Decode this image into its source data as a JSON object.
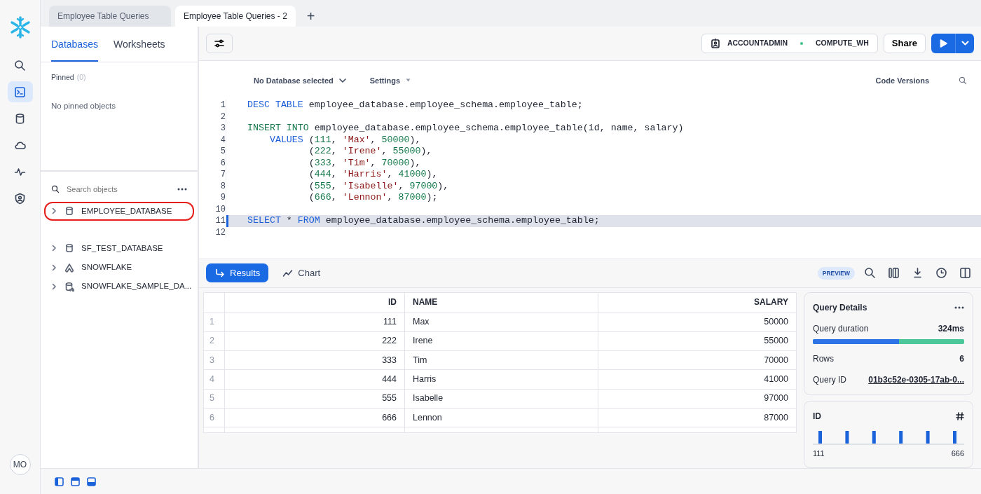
{
  "window_tabs": [
    {
      "label": "Employee Table Queries",
      "selected": false
    },
    {
      "label": "Employee Table Queries - 2",
      "selected": true
    }
  ],
  "new_tab": "+",
  "rail": [
    {
      "kind": "search",
      "selected": false
    },
    {
      "kind": "worksheet",
      "selected": true
    },
    {
      "kind": "data",
      "selected": false
    },
    {
      "kind": "cloud",
      "selected": false
    },
    {
      "kind": "activity",
      "selected": false
    },
    {
      "kind": "shield",
      "selected": false
    }
  ],
  "avatar": "MO",
  "sidebar": {
    "tabs": [
      {
        "label": "Databases",
        "selected": true
      },
      {
        "label": "Worksheets",
        "selected": false
      }
    ],
    "pinned_label": "Pinned",
    "pinned_count": "(0)",
    "pinned_empty": "No pinned objects",
    "search": {
      "placeholder": "Search objects"
    },
    "objects": [
      {
        "kind": "database",
        "name": "EMPLOYEE_DATABASE",
        "circled": true
      },
      {
        "kind": "database",
        "name": "SF_TEST_DATABASE",
        "circled": false
      },
      {
        "kind": "app",
        "name": "SNOWFLAKE",
        "circled": false
      },
      {
        "kind": "shared",
        "name": "SNOWFLAKE_SAMPLE_DA...",
        "circled": false
      }
    ]
  },
  "toolbar": {
    "role": "ACCOUNTADMIN",
    "warehouse": "COMPUTE_WH",
    "share": "Share"
  },
  "editor": {
    "database": "No Database selected",
    "settings": "Settings",
    "code_versions": "Code Versions",
    "lines": [
      {
        "number": "1",
        "highlighted": false,
        "tokens": [
          {
            "kind": "kw",
            "t": "DESC TABLE"
          },
          {
            "kind": "txt",
            "t": " employee_database.employee_schema.employee_table;"
          }
        ]
      },
      {
        "number": "2",
        "highlighted": false
      },
      {
        "number": "3",
        "highlighted": false,
        "tokens": [
          {
            "kind": "kw2",
            "t": "INSERT INTO"
          },
          {
            "kind": "txt",
            "t": " employee_database.employee_schema.employee_table(id, name, salary)"
          }
        ]
      },
      {
        "number": "4",
        "highlighted": false,
        "tokens": [
          {
            "kind": "kw",
            "t": "    VALUES"
          },
          {
            "kind": "txt",
            "t": " ("
          },
          {
            "kind": "num",
            "t": "111"
          },
          {
            "kind": "txt",
            "t": ", "
          },
          {
            "kind": "str",
            "t": "'Max'"
          },
          {
            "kind": "txt",
            "t": ", "
          },
          {
            "kind": "num",
            "t": "50000"
          },
          {
            "kind": "txt",
            "t": "),"
          }
        ]
      },
      {
        "number": "5",
        "highlighted": false,
        "tokens": [
          {
            "kind": "txt",
            "t": "           ("
          },
          {
            "kind": "num",
            "t": "222"
          },
          {
            "kind": "txt",
            "t": ", "
          },
          {
            "kind": "str",
            "t": "'Irene'"
          },
          {
            "kind": "txt",
            "t": ", "
          },
          {
            "kind": "num",
            "t": "55000"
          },
          {
            "kind": "txt",
            "t": "),"
          }
        ]
      },
      {
        "number": "6",
        "highlighted": false,
        "tokens": [
          {
            "kind": "txt",
            "t": "           ("
          },
          {
            "kind": "num",
            "t": "333"
          },
          {
            "kind": "txt",
            "t": ", "
          },
          {
            "kind": "str",
            "t": "'Tim'"
          },
          {
            "kind": "txt",
            "t": ", "
          },
          {
            "kind": "num",
            "t": "70000"
          },
          {
            "kind": "txt",
            "t": "),"
          }
        ]
      },
      {
        "number": "7",
        "highlighted": false,
        "tokens": [
          {
            "kind": "txt",
            "t": "           ("
          },
          {
            "kind": "num",
            "t": "444"
          },
          {
            "kind": "txt",
            "t": ", "
          },
          {
            "kind": "str",
            "t": "'Harris'"
          },
          {
            "kind": "txt",
            "t": ", "
          },
          {
            "kind": "num",
            "t": "41000"
          },
          {
            "kind": "txt",
            "t": "),"
          }
        ]
      },
      {
        "number": "8",
        "highlighted": false,
        "tokens": [
          {
            "kind": "txt",
            "t": "           ("
          },
          {
            "kind": "num",
            "t": "555"
          },
          {
            "kind": "txt",
            "t": ", "
          },
          {
            "kind": "str",
            "t": "'Isabelle'"
          },
          {
            "kind": "txt",
            "t": ", "
          },
          {
            "kind": "num",
            "t": "97000"
          },
          {
            "kind": "txt",
            "t": "),"
          }
        ]
      },
      {
        "number": "9",
        "highlighted": false,
        "tokens": [
          {
            "kind": "txt",
            "t": "           ("
          },
          {
            "kind": "num",
            "t": "666"
          },
          {
            "kind": "txt",
            "t": ", "
          },
          {
            "kind": "str",
            "t": "'Lennon'"
          },
          {
            "kind": "txt",
            "t": ", "
          },
          {
            "kind": "num",
            "t": "87000"
          },
          {
            "kind": "txt",
            "t": ");"
          }
        ]
      },
      {
        "number": "10",
        "highlighted": false
      },
      {
        "number": "11",
        "highlighted": true,
        "tokens": [
          {
            "kind": "kw",
            "t": "SELECT"
          },
          {
            "kind": "txt",
            "t": " * "
          },
          {
            "kind": "kw",
            "t": "FROM"
          },
          {
            "kind": "txt",
            "t": " employee_database.employee_schema.employee_table;"
          }
        ]
      },
      {
        "number": "12",
        "highlighted": false
      }
    ]
  },
  "results": {
    "tabs": [
      {
        "kind": "results",
        "label": "Results",
        "selected": true
      },
      {
        "kind": "chart",
        "label": "Chart",
        "selected": false
      }
    ],
    "badge": "PREVIEW",
    "table": {
      "columns": [
        {
          "label": "ID",
          "kind": "number"
        },
        {
          "label": "NAME",
          "kind": "text"
        },
        {
          "label": "SALARY",
          "kind": "number"
        }
      ],
      "rows": [
        {
          "number": "1",
          "cells": [
            "111",
            "Max",
            "50000"
          ]
        },
        {
          "number": "2",
          "cells": [
            "222",
            "Irene",
            "55000"
          ]
        },
        {
          "number": "3",
          "cells": [
            "333",
            "Tim",
            "70000"
          ]
        },
        {
          "number": "4",
          "cells": [
            "444",
            "Harris",
            "41000"
          ]
        },
        {
          "number": "5",
          "cells": [
            "555",
            "Isabelle",
            "97000"
          ]
        },
        {
          "number": "6",
          "cells": [
            "666",
            "Lennon",
            "87000"
          ]
        }
      ]
    }
  },
  "query_details": {
    "title": "Query Details",
    "duration_label": "Query duration",
    "duration": "324ms",
    "duration_bar": {
      "level": 0.57
    },
    "rows_label": "Rows",
    "rows": "6",
    "id_label": "Query ID",
    "id": "01b3c52e-0305-17ab-0..."
  },
  "column_summary": {
    "title": "ID",
    "min": "111",
    "max": "666"
  }
}
